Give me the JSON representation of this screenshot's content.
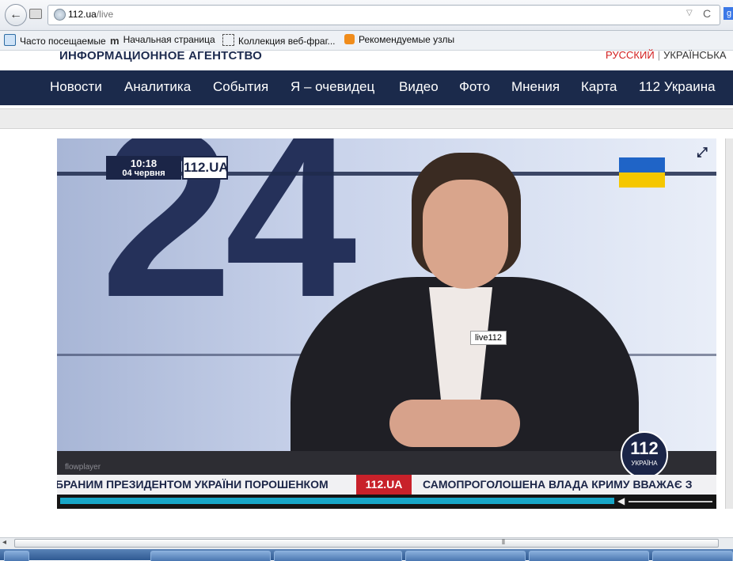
{
  "browser": {
    "url_host": "112.ua",
    "url_path": "/live",
    "bookmarks": [
      "Часто посещаемые",
      "Начальная страница",
      "Коллекция веб-фраг...",
      "Рекомендуемые узлы"
    ],
    "bookmark_icon_glyph_2": "m"
  },
  "site": {
    "agency_title": "ИНФОРМАЦИОННОЕ АГЕНТСТВО",
    "lang_ru": "РУССКИЙ",
    "lang_sep": "|",
    "lang_ua": "УКРАЇНСЬКА",
    "nav": [
      "Новости",
      "Аналитика",
      "События",
      "Я – очевидец",
      "Видео",
      "Фото",
      "Мнения",
      "Карта",
      "112 Украина"
    ]
  },
  "player": {
    "big_digits": "24",
    "clock_time": "10:18",
    "clock_date": "04 червня",
    "logo": "112.UA",
    "tooltip": "live112",
    "channel_num": "112",
    "channel_sub": "УКРАЇНА",
    "watermark": "flowplayer",
    "ticker_left": "БРАНИМ ПРЕЗИДЕНТОМ УКРАЇНИ ПОРОШЕНКОМ",
    "ticker_logo": "112.UA",
    "ticker_right": "САМОПРОГОЛОШЕНА ВЛАДА КРИМУ ВВАЖАЄ З",
    "progress_fraction": 0.84,
    "colors": {
      "navy": "#1b2547",
      "accent_red": "#c8212a",
      "progress": "#17a6c7",
      "flag_blue": "#1f64c7",
      "flag_yellow": "#f5c700"
    }
  },
  "icons": {
    "back": "back-arrow-icon",
    "reload": "reload-icon",
    "expand": "expand-icon",
    "volume": "volume-icon"
  },
  "glyphs": {
    "back": "←",
    "dropdown": "▽",
    "reload": "C",
    "gicon": "g",
    "expand": "⤢",
    "volume": "◀",
    "grip": "⦀",
    "scroll_left": "◂"
  }
}
